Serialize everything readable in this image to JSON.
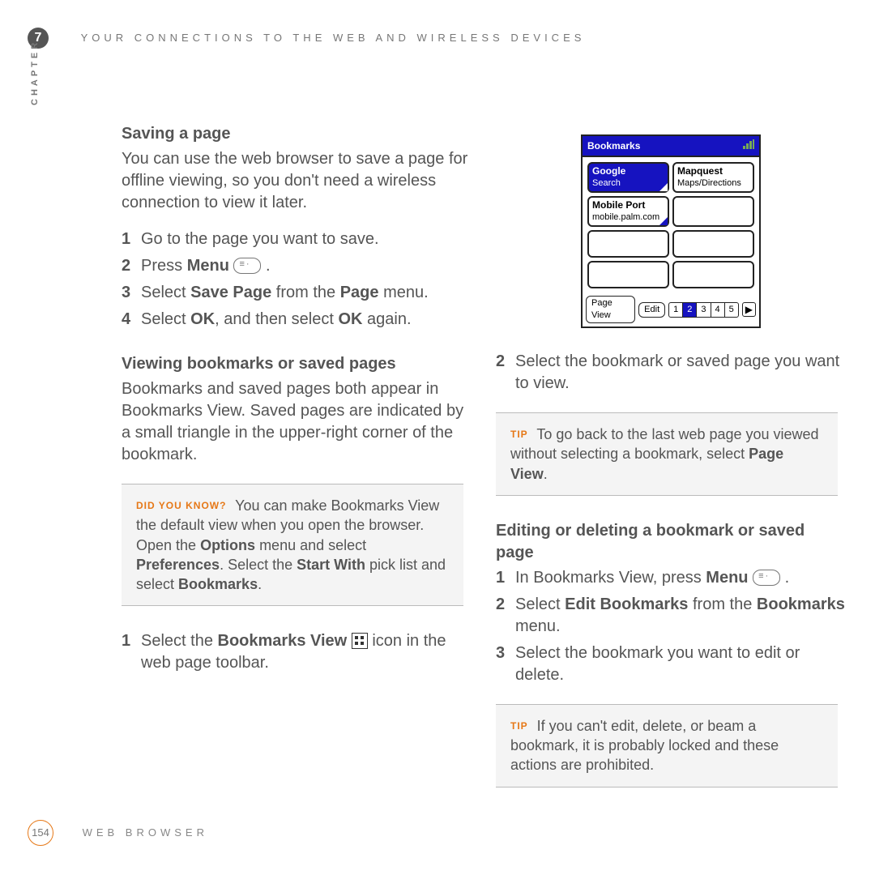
{
  "header": {
    "chapter_number": "7",
    "title": "YOUR CONNECTIONS TO THE WEB AND WIRELESS DEVICES",
    "side_label": "CHAPTER"
  },
  "left": {
    "h_saving": "Saving a page",
    "p_saving": "You can use the web browser to save a page for offline viewing, so you don't need a wireless connection to view it later.",
    "steps_saving": {
      "s1": "Go to the page you want to save.",
      "s2a": "Press ",
      "s2b_bold": "Menu",
      "s2c": " .",
      "s3a": "Select ",
      "s3b_bold": "Save Page",
      "s3c": " from the ",
      "s3d_bold": "Page",
      "s3e": " menu.",
      "s4a": "Select ",
      "s4b_bold": "OK",
      "s4c": ", and then select ",
      "s4d_bold": "OK",
      "s4e": " again."
    },
    "h_viewing": "Viewing bookmarks or saved pages",
    "p_viewing": "Bookmarks and saved pages both appear in Bookmarks View. Saved pages are indicated by a small triangle in the upper-right corner of the bookmark.",
    "callout_dyk": {
      "tag": "DID YOU KNOW?",
      "t1": " You can make Bookmarks View the default view when you open the browser. Open the ",
      "b1": "Options",
      "t2": " menu and select ",
      "b2": "Preferences",
      "t3": ". Select the ",
      "b3": "Start With",
      "t4": " pick list and select ",
      "b4": "Bookmarks",
      "t5": "."
    },
    "step_bmview": {
      "a": "Select the ",
      "b_bold": "Bookmarks View",
      "c": " icon in the web page toolbar."
    }
  },
  "right": {
    "palm": {
      "title": "Bookmarks",
      "google_l1": "Google",
      "google_l2": "Search",
      "mapquest_l1": "Mapquest",
      "mapquest_l2": "Maps/Directions",
      "mobile_l1": "Mobile Port",
      "mobile_l2": "mobile.palm.com",
      "btn_pageview": "Page View",
      "btn_edit": "Edit",
      "pager": [
        "1",
        "2",
        "3",
        "4",
        "5"
      ],
      "arrow": "▶"
    },
    "step2": {
      "a": "Select the bookmark or saved page you want to view."
    },
    "tip1": {
      "tag": "TIP",
      "t1": " To go back to the last web page you viewed without selecting a bookmark, select ",
      "b1": "Page View",
      "t2": "."
    },
    "h_edit": "Editing or deleting a bookmark or saved page",
    "steps_edit": {
      "s1a": "In Bookmarks View, press ",
      "s1b_bold": "Menu",
      "s1c": " .",
      "s2a": "Select ",
      "s2b_bold": "Edit Bookmarks",
      "s2c": " from the ",
      "s2d_bold": "Bookmarks",
      "s2e": " menu.",
      "s3": "Select the bookmark you want to edit or delete."
    },
    "tip2": {
      "tag": "TIP",
      "t1": " If you can't edit, delete, or beam a bookmark, it is probably locked and these actions are prohibited."
    }
  },
  "footer": {
    "page_number": "154",
    "title": "WEB BROWSER"
  }
}
